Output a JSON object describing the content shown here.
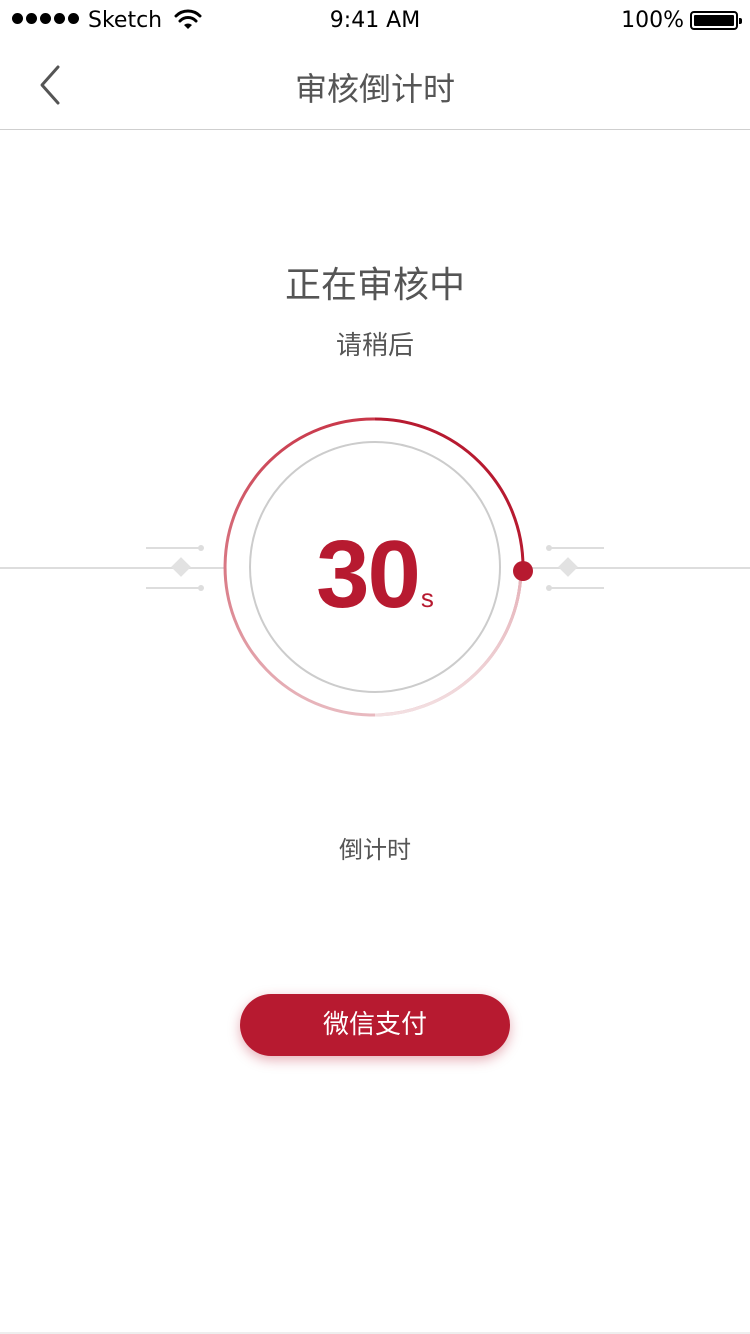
{
  "status_bar": {
    "carrier": "Sketch",
    "time": "9:41 AM",
    "battery": "100%",
    "battery_level": 1.0
  },
  "nav": {
    "title": "审核倒计时",
    "back_icon": "chevron-left-icon"
  },
  "review": {
    "title": "正在审核中",
    "subtitle": "请稍后"
  },
  "timer": {
    "value": "30",
    "unit": "s",
    "progress": 0.25,
    "caption": "倒计时"
  },
  "actions": {
    "pay_label": "微信支付"
  },
  "colors": {
    "accent": "#b71a30",
    "text": "#555555",
    "ring": "#cccccc",
    "decor": "#dddddd"
  }
}
